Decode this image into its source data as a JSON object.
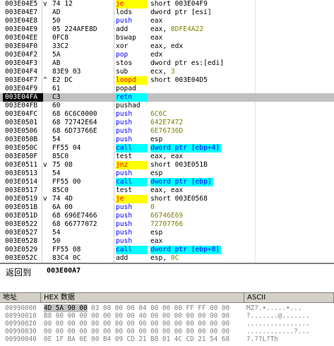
{
  "disassembly": [
    {
      "address": "003E04E5",
      "marker": "v",
      "hex": "74 12",
      "mnemonic": "je",
      "operands": "short 003E04F9",
      "style": "jump"
    },
    {
      "address": "003E04E7",
      "marker": "",
      "hex": "AD",
      "mnemonic": "lods",
      "operands": "dword ptr [esi]",
      "style": ""
    },
    {
      "address": "003E04E8",
      "marker": "",
      "hex": "50",
      "mnemonic": "push",
      "operands": "eax",
      "style": "push"
    },
    {
      "address": "003E04E9",
      "marker": "",
      "hex": "05 224AFE8D",
      "mnemonic": "add",
      "operands": "eax, 8DFE4A22",
      "style": "num"
    },
    {
      "address": "003E04EE",
      "marker": "",
      "hex": "0FC8",
      "mnemonic": "bswap",
      "operands": "eax",
      "style": ""
    },
    {
      "address": "003E04F0",
      "marker": "",
      "hex": "33C2",
      "mnemonic": "xor",
      "operands": "eax, edx",
      "style": ""
    },
    {
      "address": "003E04F2",
      "marker": "",
      "hex": "5A",
      "mnemonic": "pop",
      "operands": "edx",
      "style": "push"
    },
    {
      "address": "003E04F3",
      "marker": "",
      "hex": "AB",
      "mnemonic": "stos",
      "operands": "dword ptr es:[edi]",
      "style": ""
    },
    {
      "address": "003E04F4",
      "marker": "",
      "hex": "83E9 03",
      "mnemonic": "sub",
      "operands": "ecx, 3",
      "style": "num"
    },
    {
      "address": "003E04F7",
      "marker": "^",
      "hex": "E2 DC",
      "mnemonic": "loopd",
      "operands": "short 003E04D5",
      "style": "jump"
    },
    {
      "address": "003E04F9",
      "marker": "",
      "hex": "61",
      "mnemonic": "popad",
      "operands": "",
      "style": ""
    },
    {
      "address": "003E04FA",
      "marker": "",
      "hex": "C3",
      "mnemonic": "retn",
      "operands": "",
      "style": "ret",
      "selected": true
    },
    {
      "address": "003E04FB",
      "marker": "",
      "hex": "60",
      "mnemonic": "pushad",
      "operands": "",
      "style": ""
    },
    {
      "address": "003E04FC",
      "marker": "",
      "hex": "68 6C6C0000",
      "mnemonic": "push",
      "operands": "6C6C",
      "style": "pushnum"
    },
    {
      "address": "003E0501",
      "marker": "",
      "hex": "68 72742E64",
      "mnemonic": "push",
      "operands": "642E7472",
      "style": "pushnum"
    },
    {
      "address": "003E0506",
      "marker": "",
      "hex": "68 6D73766E",
      "mnemonic": "push",
      "operands": "6E76736D",
      "style": "pushnum"
    },
    {
      "address": "003E050B",
      "marker": "",
      "hex": "54",
      "mnemonic": "push",
      "operands": "esp",
      "style": "push"
    },
    {
      "address": "003E050C",
      "marker": "",
      "hex": "FF55 04",
      "mnemonic": "call",
      "operands": "dword ptr [ebp+4]",
      "style": "call"
    },
    {
      "address": "003E050F",
      "marker": "",
      "hex": "85C0",
      "mnemonic": "test",
      "operands": "eax, eax",
      "style": ""
    },
    {
      "address": "003E0511",
      "marker": "v",
      "hex": "75 08",
      "mnemonic": "jnz",
      "operands": "short 003E051B",
      "style": "jump"
    },
    {
      "address": "003E0513",
      "marker": "",
      "hex": "54",
      "mnemonic": "push",
      "operands": "esp",
      "style": "push"
    },
    {
      "address": "003E0514",
      "marker": "",
      "hex": "FF55 00",
      "mnemonic": "call",
      "operands": "dword ptr [ebp]",
      "style": "call"
    },
    {
      "address": "003E0517",
      "marker": "",
      "hex": "85C0",
      "mnemonic": "test",
      "operands": "eax, eax",
      "style": ""
    },
    {
      "address": "003E0519",
      "marker": "v",
      "hex": "74 4D",
      "mnemonic": "je",
      "operands": "short 003E0568",
      "style": "jump"
    },
    {
      "address": "003E051B",
      "marker": "",
      "hex": "6A 00",
      "mnemonic": "push",
      "operands": "0",
      "style": "pushnum"
    },
    {
      "address": "003E051D",
      "marker": "",
      "hex": "68 696E7466",
      "mnemonic": "push",
      "operands": "66746E69",
      "style": "pushnum"
    },
    {
      "address": "003E0522",
      "marker": "",
      "hex": "68 66777072",
      "mnemonic": "push",
      "operands": "72707766",
      "style": "pushnum"
    },
    {
      "address": "003E0527",
      "marker": "",
      "hex": "54",
      "mnemonic": "push",
      "operands": "esp",
      "style": "push"
    },
    {
      "address": "003E0528",
      "marker": "",
      "hex": "50",
      "mnemonic": "push",
      "operands": "eax",
      "style": "push"
    },
    {
      "address": "003E0529",
      "marker": "",
      "hex": "FF55 08",
      "mnemonic": "call",
      "operands": "dword ptr [ebp+8]",
      "style": "call"
    },
    {
      "address": "003E052C",
      "marker": "",
      "hex": "83C4 0C",
      "mnemonic": "add",
      "operands": "esp, 0C",
      "style": "num"
    }
  ],
  "info_pane": {
    "label": "返回到",
    "value": "003E00A7"
  },
  "dump": {
    "headers": {
      "address": "地址",
      "hex": "HEX 数据",
      "ascii": "ASCII"
    },
    "rows": [
      {
        "address": "00990000",
        "hex": "4D 5A 90 00 03 00 00 00 04 00 00 00 FF FF 00 00",
        "ascii": "MZ?.•.....•...",
        "hl": "4D 5A 90 00"
      },
      {
        "address": "00990010",
        "hex": "B8 00 00 00 00 00 00 00 40 00 00 00 00 00 00 00",
        "ascii": "?.......@.......",
        "hl": ""
      },
      {
        "address": "00990020",
        "hex": "00 00 00 00 00 00 00 00 00 00 00 00 00 00 00 00",
        "ascii": "................",
        "hl": ""
      },
      {
        "address": "00990030",
        "hex": "00 00 00 00 00 00 00 00 00 00 00 00 80 00 00 00",
        "ascii": "............?...",
        "hl": ""
      },
      {
        "address": "00990040",
        "hex": "0E 1F BA 0E 00 B4 09 CD 21 B8 01 4C CD 21 54 68",
        "ascii": "?.??L?Th",
        "hl": ""
      }
    ]
  },
  "colors": {
    "jump_bg": "#ffff00",
    "jump_fg": "#ff0000",
    "call_bg": "#00ffff",
    "call_fg": "#0000ff",
    "push_fg": "#0000ff",
    "num_fg": "#808000",
    "selected_bg": "#c0c0c0"
  }
}
